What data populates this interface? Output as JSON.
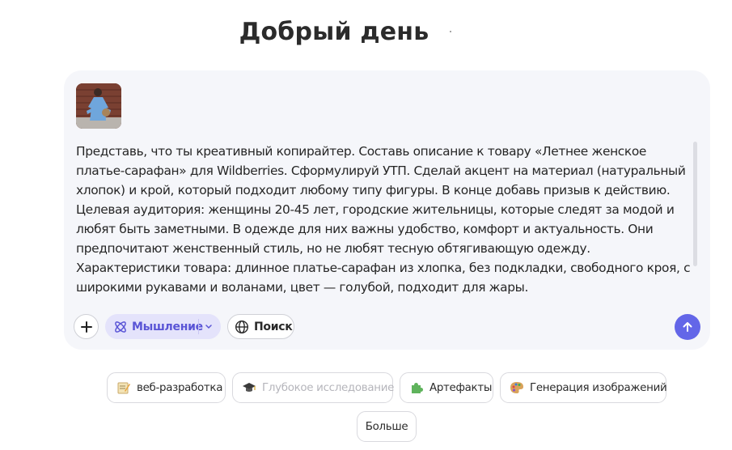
{
  "greeting": "Добрый день",
  "prompt": {
    "paragraphs": [
      "Представь, что ты креативный копирайтер. Составь описание к товару «Летнее женское платье-сарафан» для Wildberries. Сформулируй УТП. Сделай акцент на материал (натуральный хлопок) и крой, который подходит любому типу фигуры. В конце добавь призыв к действию.",
      "Целевая аудитория: женщины 20-45 лет, городские жительницы, которые следят за модой и любят быть заметными. В одежде для них важны удобство, комфорт и актуальность. Они предпочитают женственный стиль, но не любят тесную обтягивающую одежду.",
      "Характеристики товара: длинное платье-сарафан из хлопка, без подкладки, свободного кроя, с широкими рукавами и воланами, цвет — голубой, подходит для жары."
    ]
  },
  "toolbar": {
    "thinking_label": "Мышление",
    "search_label": "Поиск"
  },
  "suggestions": {
    "web_dev": "веб-разработка",
    "deep_research": "Глубокое исследование",
    "artifacts": "Артефакты",
    "image_gen": "Генерация изображений",
    "more": "Больше"
  },
  "colors": {
    "accent": "#6366e8",
    "thinking_bg": "#e4e3fb",
    "thinking_text": "#5a55d6",
    "composer_bg": "#f5f6fa"
  },
  "icons": {
    "plus": "plus-icon",
    "thinking": "atom-icon",
    "search": "globe-icon",
    "send": "arrow-up-icon"
  }
}
